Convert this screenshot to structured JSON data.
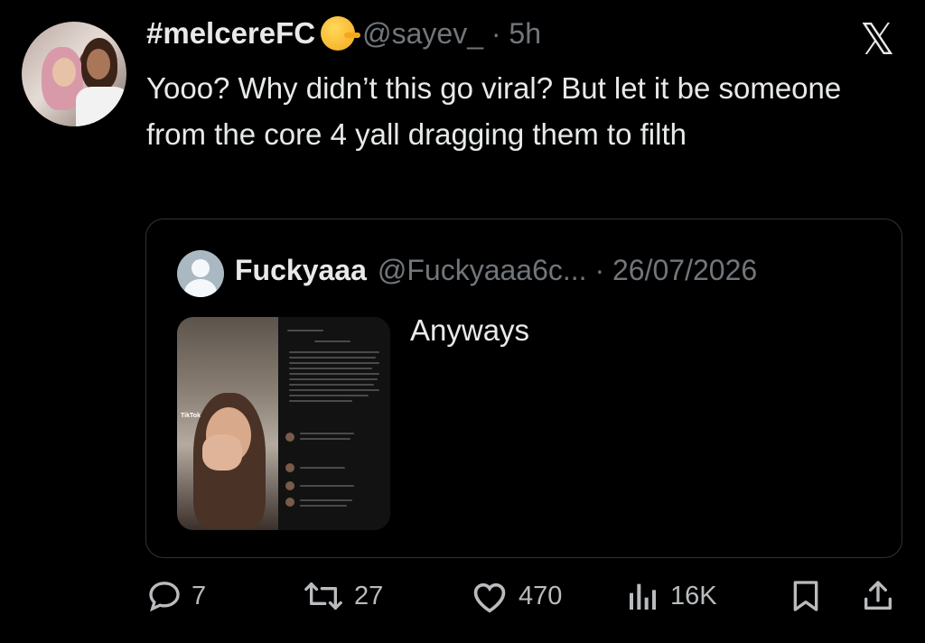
{
  "tweet": {
    "display_name": "#melcereFC",
    "handle_time": "@sayev_ · 5h",
    "text": "Yooo? Why didn’t this go viral? But let it be someone from the core 4 yall dragging them to filth"
  },
  "quoted_tweet": {
    "display_name": "Fuckyaaa",
    "handle_date": "@Fuckyaaa6c... · 26/07/2026",
    "text": "Anyways",
    "media_watermark": "TikTok"
  },
  "actions": {
    "replies": "7",
    "reposts": "27",
    "likes": "470",
    "views": "16K"
  },
  "icons": {
    "logo": "x-logo-icon",
    "reply": "reply-icon",
    "repost": "repost-icon",
    "like": "heart-icon",
    "views": "views-icon",
    "bookmark": "bookmark-icon",
    "share": "share-icon"
  },
  "colors": {
    "background": "#000000",
    "text": "#e7e9ea",
    "secondary": "#71767b",
    "border": "#2f3336"
  }
}
